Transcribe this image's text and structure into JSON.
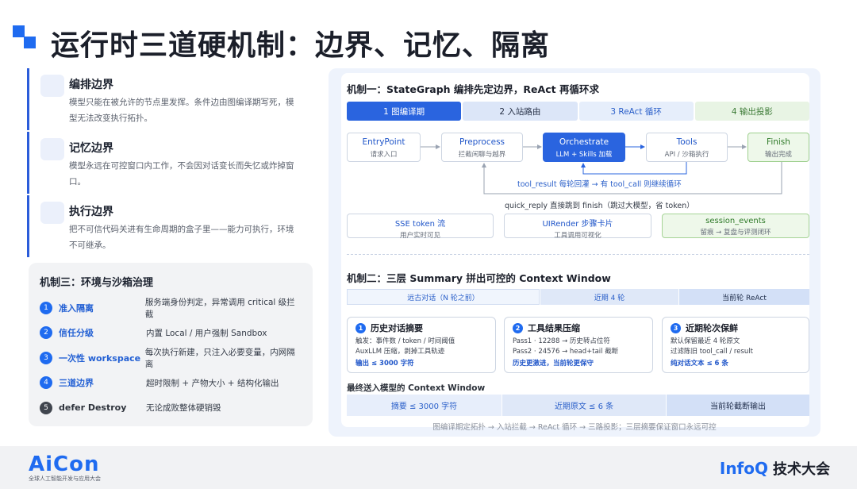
{
  "page": {
    "title": "运行时三道硬机制：边界、记忆、隔离"
  },
  "left_cards": [
    {
      "title": "编排边界",
      "desc": "模型只能在被允许的节点里发挥。条件边由图编译期写死，模型无法改变执行拓扑。"
    },
    {
      "title": "记忆边界",
      "desc": "模型永远在可控窗口内工作，不会因对话变长而失忆或炸掉窗口。"
    },
    {
      "title": "执行边界",
      "desc": "把不可信代码关进有生命周期的盒子里——能力可执行，环境不可继承。"
    }
  ],
  "mech3": {
    "title": "机制三：环境与沙箱治理",
    "rows": [
      {
        "num": "1",
        "label": "准入隔离",
        "desc": "服务端身份判定，异常调用 critical 级拦截"
      },
      {
        "num": "2",
        "label": "信任分级",
        "desc": "内置 Local / 用户强制 Sandbox"
      },
      {
        "num": "3",
        "label": "一次性 workspace",
        "desc": "每次执行新建，只注入必要变量，内网隔离"
      },
      {
        "num": "4",
        "label": "三道边界",
        "desc": "超时限制 + 产物大小 + 结构化输出"
      },
      {
        "num": "5",
        "label": "defer Destroy",
        "desc": "无论成败整体硬销毁"
      }
    ]
  },
  "mech1": {
    "title": "机制一：StateGraph 编排先定边界，ReAct 再循环求",
    "tabs": [
      "1 图编译期",
      "2 入站路由",
      "3 ReAct 循环",
      "4 输出投影"
    ],
    "nodes": [
      {
        "name": "EntryPoint",
        "sub": "请求入口"
      },
      {
        "name": "Preprocess",
        "sub": "拦截闲聊与越界"
      },
      {
        "name": "Orchestrate",
        "sub": "LLM + Skills 加载"
      },
      {
        "name": "Tools",
        "sub": "API / 沙箱执行"
      },
      {
        "name": "Finish",
        "sub": "输出完成"
      }
    ],
    "loop_label": "tool_result 每轮回灌 → 有 tool_call 则继续循环",
    "quick_label": "quick_reply 直接跳到 finish（跳过大模型，省 token）",
    "outputs": [
      {
        "name": "SSE token 流",
        "sub": "用户实时可见"
      },
      {
        "name": "UIRender 步骤卡片",
        "sub": "工具调用可视化"
      },
      {
        "name": "session_events",
        "sub": "留痕 → 复盘与评测闭环"
      }
    ]
  },
  "mech2": {
    "title": "机制二：三层 Summary 拼出可控的 Context Window",
    "scale": [
      "远古对话（N 轮之前）",
      "近期 4 轮",
      "当前轮 ReAct"
    ],
    "cards": [
      {
        "num": "1",
        "title": "历史对话摘要",
        "lines": [
          "触发：事件数 / token / 时间阈值",
          "AuxLLM 压缩，剥掉工具轨迹"
        ],
        "foot": "输出 ≤ 3000 字符"
      },
      {
        "num": "2",
        "title": "工具结果压缩",
        "lines": [
          "Pass1 · 12288 → 历史转占位符",
          "Pass2 · 24576 → head+tail 截断"
        ],
        "foot": "历史更激进，当前轮更保守"
      },
      {
        "num": "3",
        "title": "近期轮次保鲜",
        "lines": [
          "默认保留最近 4 轮原文",
          "过滤陈旧 tool_call / result"
        ],
        "foot": "纯对话文本 ≤ 6 条"
      }
    ],
    "final_title": "最终送入模型的 Context Window",
    "final_bars": [
      "摘要 ≤ 3000 字符",
      "近期原文 ≤ 6 条",
      "当前轮截断输出"
    ]
  },
  "footnote": "图编译期定拓扑 → 入站拦截 → ReAct 循环 → 三路投影；三层摘要保证窗口永远可控",
  "footer": {
    "aicon": "AiCon",
    "aicon_sub": "全球人工智能开发与应用大会",
    "infoq": "InfoQ",
    "infoq_cn": "技术大会"
  },
  "colors": {
    "accent": "#1f6bf0",
    "green": "#2f7a29",
    "panel_bg": "#eef3fc"
  }
}
